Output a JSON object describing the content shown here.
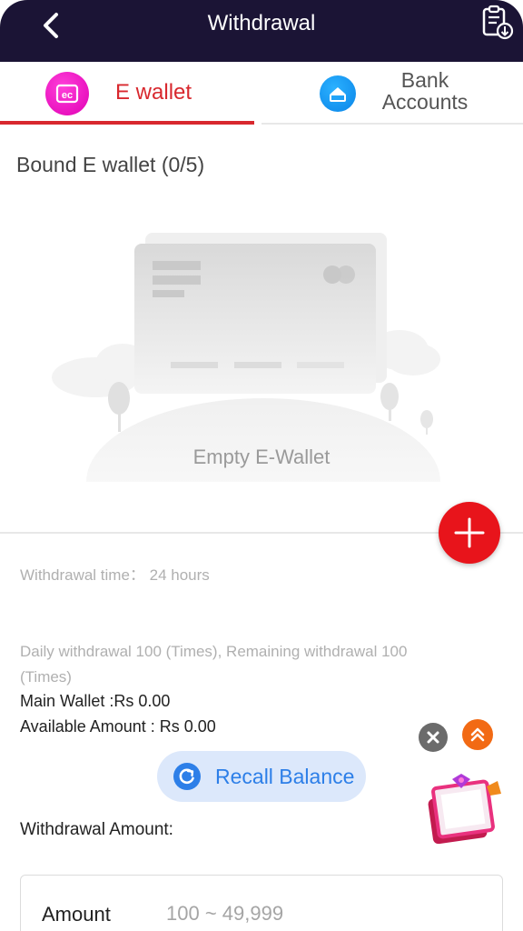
{
  "header": {
    "title": "Withdrawal",
    "back_icon": "chevron-left-icon",
    "record_icon": "clipboard-download-icon"
  },
  "tabs": [
    {
      "label": "E wallet",
      "icon": "ewallet-icon",
      "active": true
    },
    {
      "label": "Bank Accounts",
      "label_line1": "Bank",
      "label_line2": "Accounts",
      "icon": "bank-card-icon",
      "active": false
    }
  ],
  "ewallet": {
    "bound_title": "Bound E wallet (0/5)",
    "empty_text": "Empty E-Wallet"
  },
  "info": {
    "withdrawal_time": "Withdrawal time： 24 hours",
    "daily_line1": "Daily withdrawal 100 (Times), Remaining withdrawal 100",
    "daily_line2": "(Times)",
    "main_wallet": "Main Wallet :Rs 0.00",
    "available_amount": "Available Amount : Rs 0.00"
  },
  "recall": {
    "label": "Recall Balance",
    "icon": "refresh-icon"
  },
  "withdrawal": {
    "label": "Withdrawal Amount:",
    "amount_label": "Amount",
    "amount_placeholder": "100 ~ 49,999"
  },
  "colors": {
    "header_bg": "#1b1435",
    "accent_red": "#d8282e",
    "add_button": "#e8141b",
    "recall_blue": "#2d7fe8",
    "ewallet_icon": "#e000b4",
    "bank_icon": "#0a85e8"
  }
}
